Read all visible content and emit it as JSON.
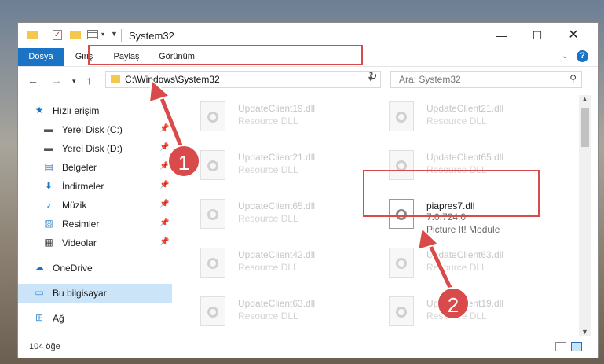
{
  "window": {
    "title": "System32"
  },
  "window_controls": {
    "minimize": "—",
    "maximize": "☐",
    "close": "✕"
  },
  "ribbon": {
    "tabs": [
      "Dosya",
      "Giriş",
      "Paylaş",
      "Görünüm"
    ],
    "help": "?"
  },
  "address": {
    "path": "C:\\Windows\\System32"
  },
  "search": {
    "placeholder": "Ara: System32"
  },
  "sidebar": {
    "items": [
      {
        "label": "Hızlı erişim",
        "icon": "star-icon"
      },
      {
        "label": "Yerel Disk (C:)",
        "icon": "drive-icon"
      },
      {
        "label": "Yerel Disk (D:)",
        "icon": "drive-icon"
      },
      {
        "label": "Belgeler",
        "icon": "documents-icon"
      },
      {
        "label": "İndirmeler",
        "icon": "download-icon"
      },
      {
        "label": "Müzik",
        "icon": "music-icon"
      },
      {
        "label": "Resimler",
        "icon": "pictures-icon"
      },
      {
        "label": "Videolar",
        "icon": "videos-icon"
      },
      {
        "label": "OneDrive",
        "icon": "cloud-icon"
      },
      {
        "label": "Bu bilgisayar",
        "icon": "computer-icon"
      },
      {
        "label": "Ağ",
        "icon": "network-icon"
      }
    ]
  },
  "files": [
    {
      "name": "UpdateClient19.dll",
      "desc": "Resource DLL"
    },
    {
      "name": "UpdateClient21.dll",
      "desc": "Resource DLL"
    },
    {
      "name": "UpdateClient21.dll",
      "desc": "Resource DLL"
    },
    {
      "name": "UpdateClient65.dll",
      "desc": "Resource DLL"
    },
    {
      "name": "UpdateClient65.dll",
      "desc": "Resource DLL"
    },
    {
      "name": "piapres7.dll",
      "version": "7.0.724.0",
      "desc": "Picture It! Module"
    },
    {
      "name": "UpdateClient42.dll",
      "desc": "Resource DLL"
    },
    {
      "name": "UpdateClient63.dll",
      "desc": "Resource DLL"
    },
    {
      "name": "UpdateClient63.dll",
      "desc": "Resource DLL"
    },
    {
      "name": "UpdateClient19.dll",
      "desc": "Resource DLL"
    }
  ],
  "status": {
    "count": "104 öğe"
  },
  "annotations": {
    "step1": "1",
    "step2": "2",
    "color": "#d94a4a"
  }
}
